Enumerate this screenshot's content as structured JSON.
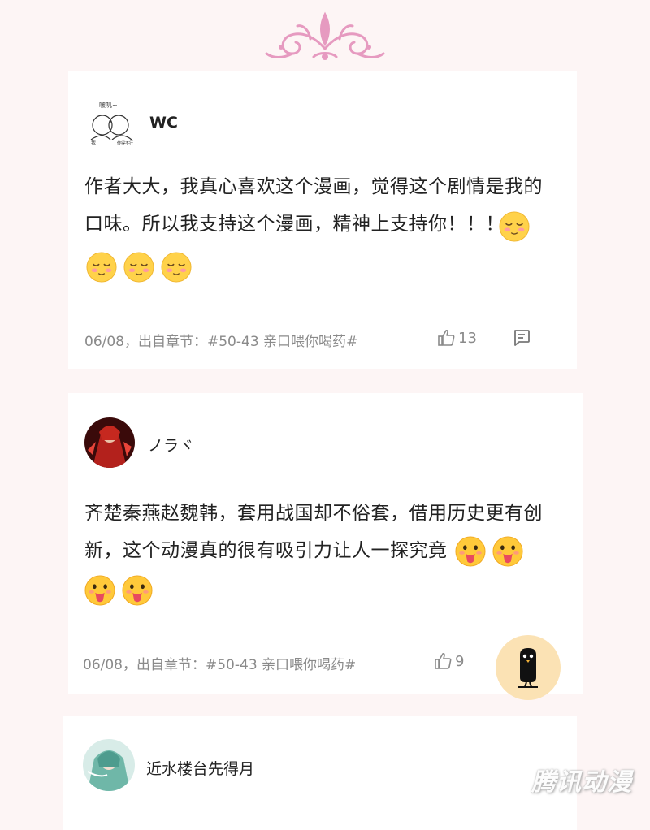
{
  "colors": {
    "ornament": "#e69ac0",
    "fab_bg": "#fbe2b4",
    "meta_text": "#8a8a8a"
  },
  "comments": [
    {
      "avatar_icon": "sketch-kiss-avatar-icon",
      "avatar_caption_top": "啵叽~",
      "avatar_caption_left": "我",
      "avatar_caption_right": "傻得不行",
      "username": "WC",
      "text_line1": "作者大大，我真心喜欢这个漫画，觉得这个剧情是我的",
      "text_line2": "口味。所以我支持这个漫画，精神上支持你！！！",
      "emoji_name": "shy-blush-emoji",
      "meta": "06/08，出自章节：#50-43 亲口喂你喝药#",
      "likes": "13",
      "reply_icon": "comment-bubble-icon"
    },
    {
      "avatar_icon": "red-anime-avatar-icon",
      "username": "ノラヾ",
      "text_line1": "齐楚秦燕赵魏韩，套用战国却不俗套，借用历史更有创",
      "text_line2": "新，这个动漫真的很有吸引力让人一探究竟",
      "emoji_name": "tongue-out-emoji",
      "meta": "06/08，出自章节：#50-43 亲口喂你喝药#",
      "likes": "9"
    },
    {
      "avatar_icon": "teal-anime-avatar-icon",
      "username": "近水楼台先得月"
    }
  ],
  "fab_icon": "black-bird-icon",
  "watermark": "腾讯动漫"
}
